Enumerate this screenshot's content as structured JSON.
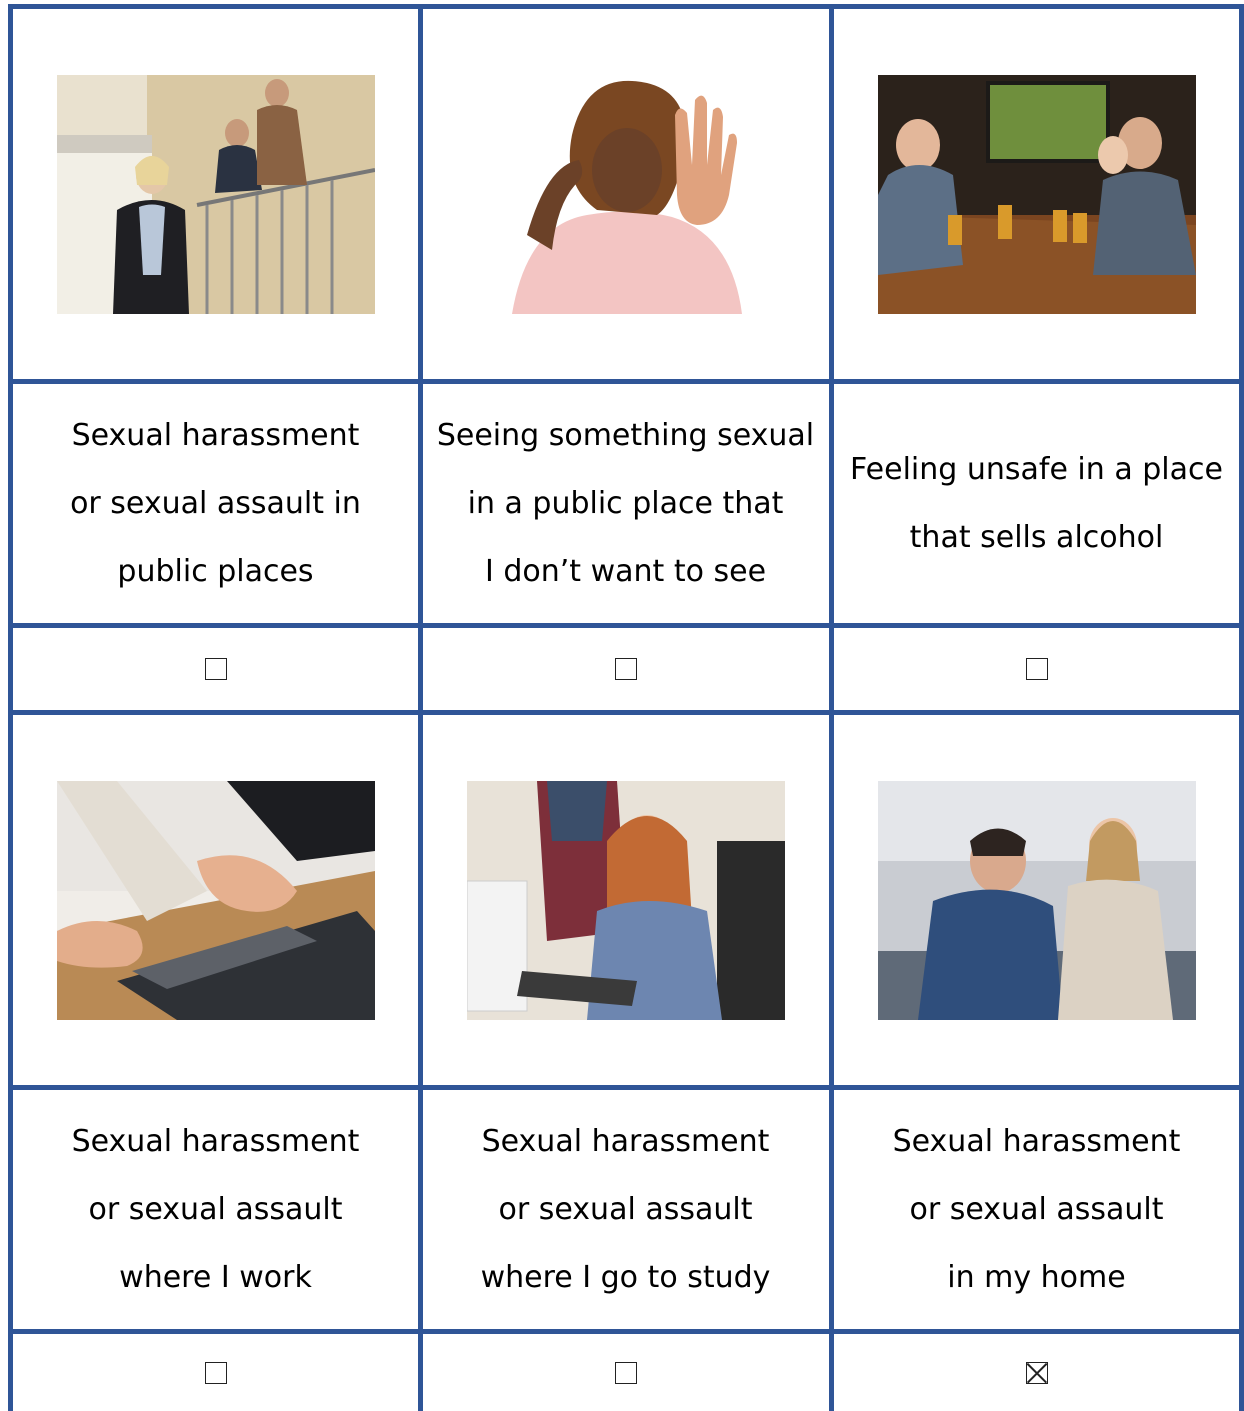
{
  "cards": [
    {
      "label": "Sexual harassment\nor sexual assault in\npublic places",
      "checked": false
    },
    {
      "label": "Seeing something sexual\nin a public place that\nI don’t want to see",
      "checked": false
    },
    {
      "label": "Feeling unsafe in a place\nthat sells alcohol",
      "checked": false
    },
    {
      "label": "Sexual harassment\nor sexual assault\nwhere I work",
      "checked": false
    },
    {
      "label": "Sexual harassment\nor sexual assault\nwhere I go to study",
      "checked": false
    },
    {
      "label": "Sexual harassment\nor sexual assault\nin my home",
      "checked": true
    }
  ],
  "colors": {
    "grid_border": "#2f5597"
  }
}
